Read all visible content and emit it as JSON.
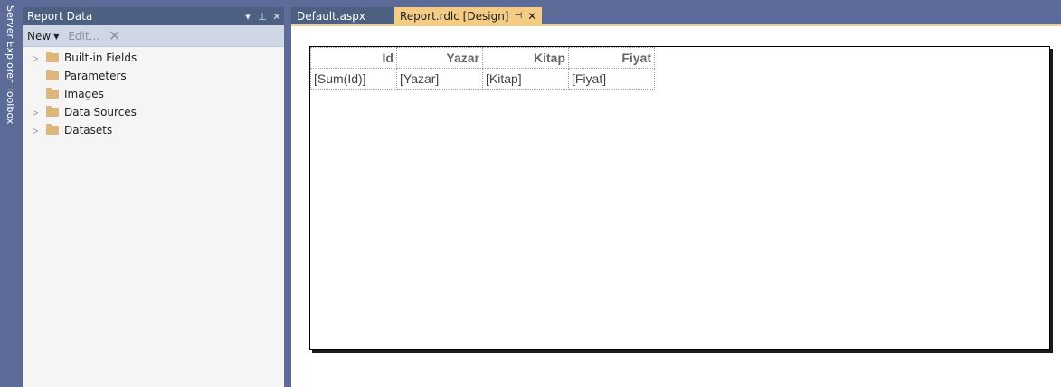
{
  "side_strip": {
    "server_explorer": "Server Explorer",
    "toolbox": "Toolbox"
  },
  "report_data_panel": {
    "title": "Report Data",
    "header_buttons": {
      "dropdown": "▾",
      "pin": "⊥",
      "close": "✕"
    },
    "toolbar": {
      "new_label": "New",
      "edit_label": "Edit...",
      "delete_glyph": "✕"
    },
    "tree": [
      {
        "label": "Built-in Fields",
        "expandable": true
      },
      {
        "label": "Parameters",
        "expandable": false
      },
      {
        "label": "Images",
        "expandable": false
      },
      {
        "label": "Data Sources",
        "expandable": true
      },
      {
        "label": "Datasets",
        "expandable": true
      }
    ]
  },
  "tabs": [
    {
      "label": "Default.aspx",
      "active": false
    },
    {
      "label": "Report.rdlc [Design]",
      "active": true,
      "pin": "⊣",
      "close": "✕"
    }
  ],
  "report_table": {
    "headers": [
      "Id",
      "Yazar",
      "Kitap",
      "Fiyat"
    ],
    "cells": [
      "[Sum(Id)]",
      "[Yazar]",
      "[Kitap]",
      "[Fiyat]"
    ]
  },
  "colors": {
    "ide_background": "#5d6b99",
    "panel_header": "#4d6082",
    "active_tab": "#f5cc84",
    "folder": "#dcb67a"
  }
}
